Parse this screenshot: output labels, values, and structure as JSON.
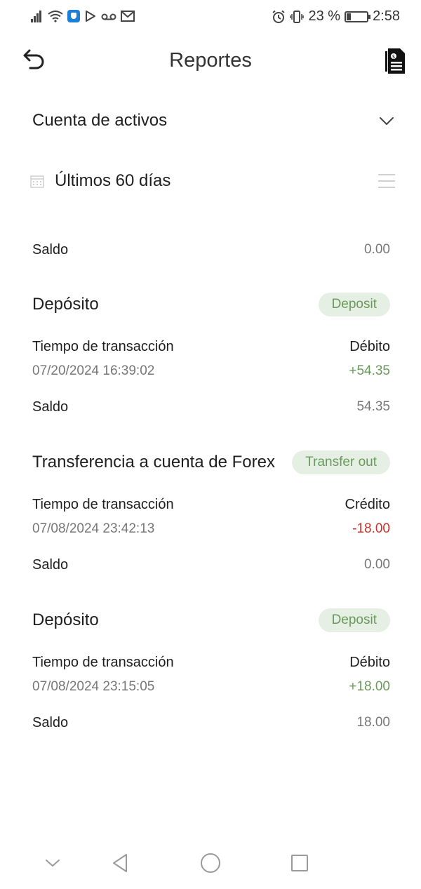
{
  "status_bar": {
    "battery_text": "23 %",
    "battery_level": 0.23,
    "time": "2:58"
  },
  "header": {
    "title": "Reportes"
  },
  "account_selector": {
    "label": "Cuenta de activos"
  },
  "date_filter": {
    "label": "Últimos 60 días"
  },
  "opening_balance": {
    "label": "Saldo",
    "value": "0.00"
  },
  "transactions": [
    {
      "title": "Depósito",
      "badge": "Deposit",
      "time_label": "Tiempo de transacción",
      "time": "07/20/2024 16:39:02",
      "amount_label": "Débito",
      "amount": "+54.35",
      "balance_label": "Saldo",
      "balance": "54.35"
    },
    {
      "title": "Transferencia a cuenta de Forex",
      "badge": "Transfer out",
      "time_label": "Tiempo de transacción",
      "time": "07/08/2024 23:42:13",
      "amount_label": "Crédito",
      "amount": "-18.00",
      "balance_label": "Saldo",
      "balance": "0.00"
    },
    {
      "title": "Depósito",
      "badge": "Deposit",
      "time_label": "Tiempo de transacción",
      "time": "07/08/2024 23:15:05",
      "amount_label": "Débito",
      "amount": "+18.00",
      "balance_label": "Saldo",
      "balance": "18.00"
    }
  ],
  "colors": {
    "positive": "#6a9a5b",
    "negative": "#d0302a",
    "badge_bg": "#e6efe3"
  },
  "icons": {
    "back": "undo-arrow-icon",
    "report": "document-report-icon",
    "account_dropdown": "chevron-down-icon",
    "calendar": "calendar-icon",
    "filter": "filter-lines-icon",
    "nav_collapse": "chevron-down-icon",
    "nav_back": "triangle-back-icon",
    "nav_home": "circle-home-icon",
    "nav_recents": "square-recents-icon"
  }
}
